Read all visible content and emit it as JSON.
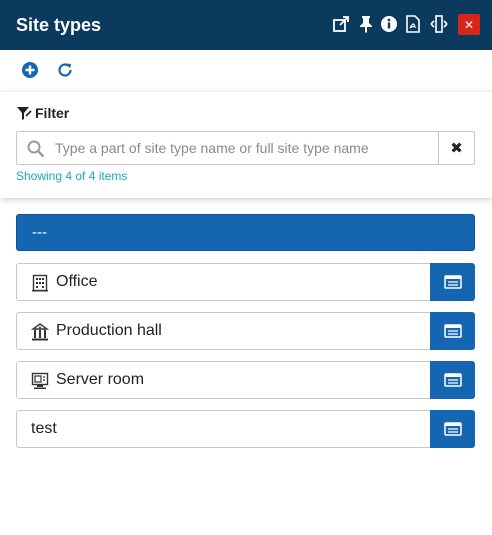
{
  "header": {
    "title": "Site types"
  },
  "filter": {
    "label": "Filter",
    "placeholder": "Type a part of site type name or full site type name",
    "value": "",
    "count_text": "Showing 4 of 4 items"
  },
  "selected_item": {
    "label": "---"
  },
  "items": [
    {
      "label": "Office",
      "icon": "building-icon"
    },
    {
      "label": "Production hall",
      "icon": "factory-icon"
    },
    {
      "label": "Server room",
      "icon": "server-monitor-icon"
    },
    {
      "label": "test",
      "icon": ""
    }
  ],
  "colors": {
    "header_bg": "#0b3a5f",
    "accent_blue": "#1566b0",
    "close_red": "#d9261c",
    "count_teal": "#1aa6b7"
  }
}
